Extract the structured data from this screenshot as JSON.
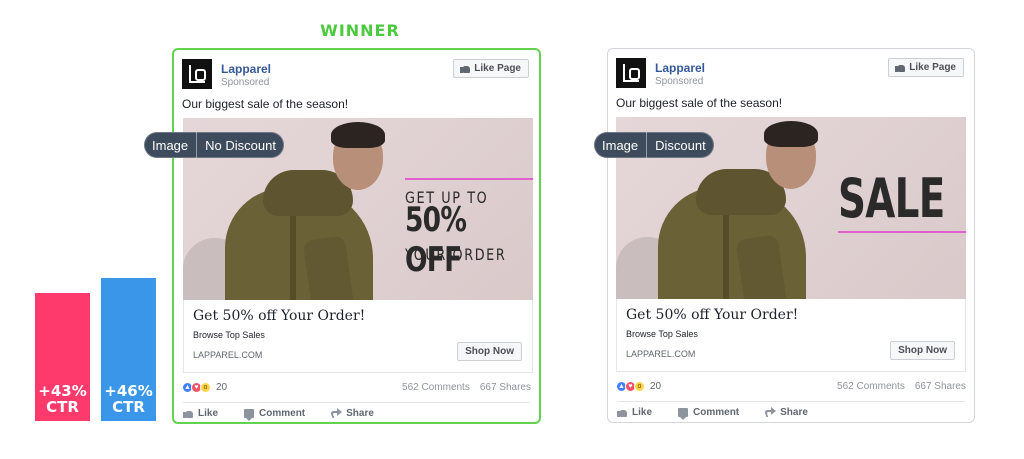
{
  "winner_label": "WINNER",
  "ctr_bars": [
    {
      "value": "+43%",
      "label": "CTR",
      "color": "#fe3a6c"
    },
    {
      "value": "+46%",
      "label": "CTR",
      "color": "#3a96e9"
    }
  ],
  "ads": [
    {
      "variant": {
        "type": "Image",
        "name": "No Discount"
      },
      "brand": "Lapparel",
      "sponsored": "Sponsored",
      "like_page": "Like Page",
      "post_text": "Our biggest sale of the season!",
      "creative": {
        "line1": "GET UP TO",
        "line2": "50% OFF",
        "line3": "YOUR ORDER"
      },
      "headline": "Get 50% off Your Order!",
      "description": "Browse Top Sales",
      "url": "LAPPAREL.COM",
      "cta": "Shop Now",
      "reaction_count": "20",
      "comments": "562 Comments",
      "shares": "667 Shares",
      "actions": {
        "like": "Like",
        "comment": "Comment",
        "share": "Share"
      },
      "border_color": "#62d24f"
    },
    {
      "variant": {
        "type": "Image",
        "name": "Discount"
      },
      "brand": "Lapparel",
      "sponsored": "Sponsored",
      "like_page": "Like Page",
      "post_text": "Our biggest sale of the season!",
      "creative": {
        "line1": "SALE"
      },
      "headline": "Get 50% off Your Order!",
      "description": "Browse Top Sales",
      "url": "LAPPAREL.COM",
      "cta": "Shop Now",
      "reaction_count": "20",
      "comments": "562 Comments",
      "shares": "667 Shares",
      "actions": {
        "like": "Like",
        "comment": "Comment",
        "share": "Share"
      },
      "border_color": "#d3d6db"
    }
  ],
  "colors": {
    "brand_link": "#365899",
    "winner": "#4cc93e",
    "pill_bg": "#3e4b5c",
    "accent_line": "#e15fcf"
  },
  "icons": {
    "reactions": [
      "like-reaction-icon",
      "love-reaction-icon",
      "wow-reaction-icon"
    ],
    "thumb": "thumbs-up-icon",
    "comment": "comment-icon",
    "share": "share-icon"
  }
}
